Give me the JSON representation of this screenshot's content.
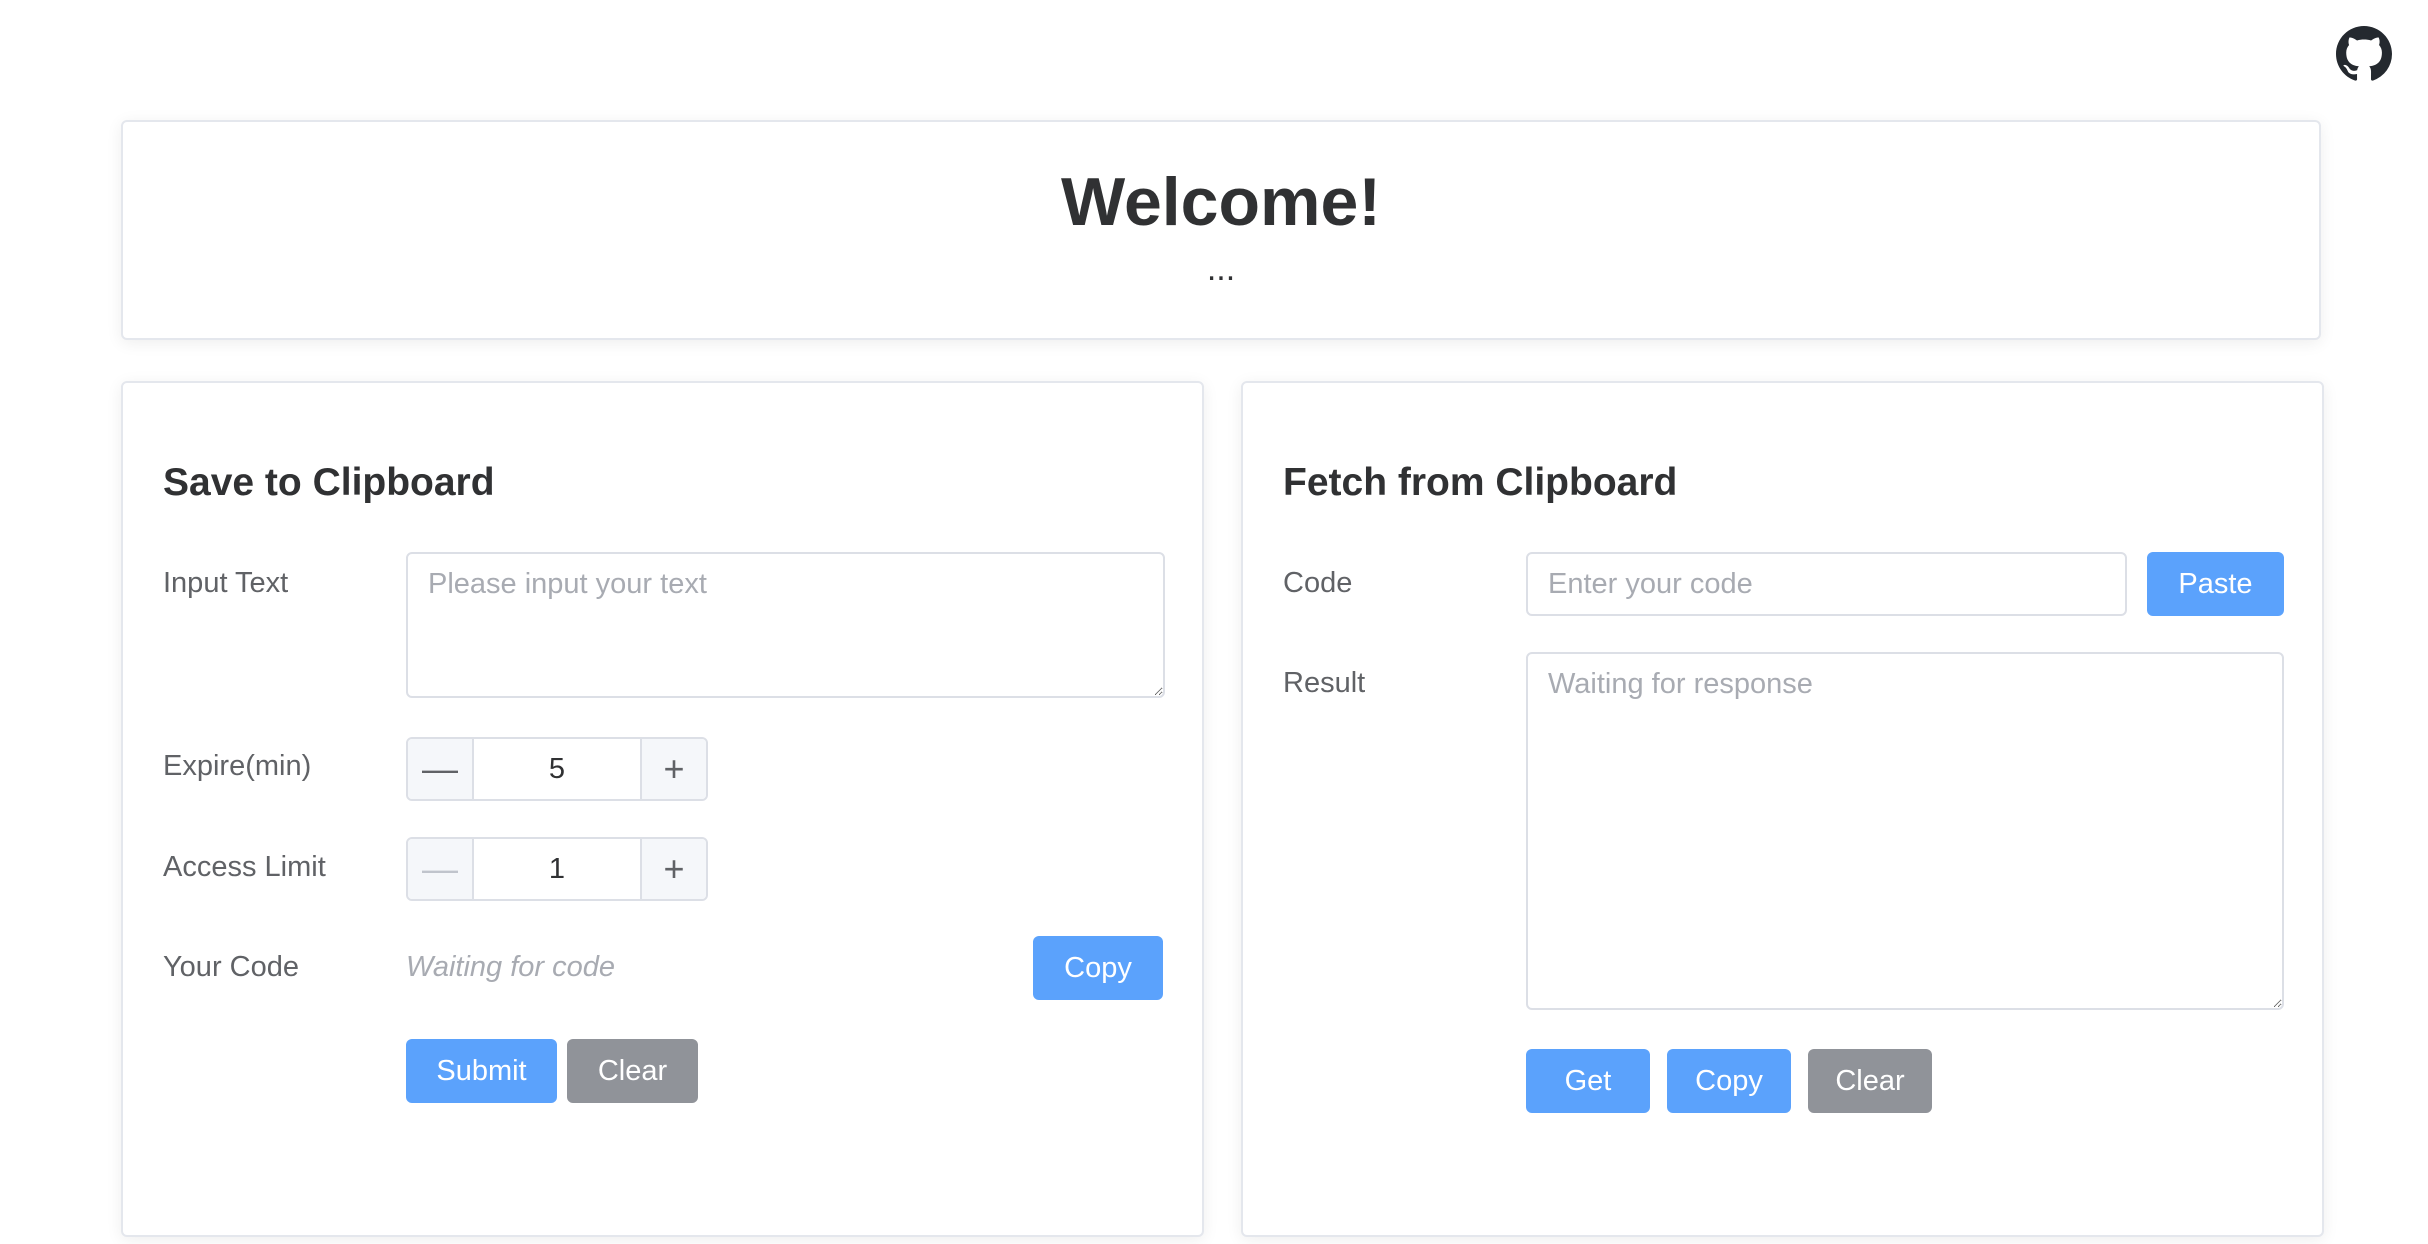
{
  "header": {
    "github_icon": "github-icon"
  },
  "welcome": {
    "title": "Welcome!",
    "subtitle": "..."
  },
  "save": {
    "title": "Save to Clipboard",
    "input_label": "Input Text",
    "input_placeholder": "Please input your text",
    "expire_label": "Expire(min)",
    "expire_value": "5",
    "access_label": "Access Limit",
    "access_value": "1",
    "minus_symbol": "—",
    "plus_symbol": "+",
    "code_label": "Your Code",
    "code_placeholder": "Waiting for code",
    "copy_label": "Copy",
    "submit_label": "Submit",
    "clear_label": "Clear"
  },
  "fetch": {
    "title": "Fetch from Clipboard",
    "code_label": "Code",
    "code_placeholder": "Enter your code",
    "paste_label": "Paste",
    "result_label": "Result",
    "result_placeholder": "Waiting for response",
    "get_label": "Get",
    "copy_label": "Copy",
    "clear_label": "Clear"
  },
  "colors": {
    "primary": "#5ba2fc",
    "secondary": "#909399"
  }
}
